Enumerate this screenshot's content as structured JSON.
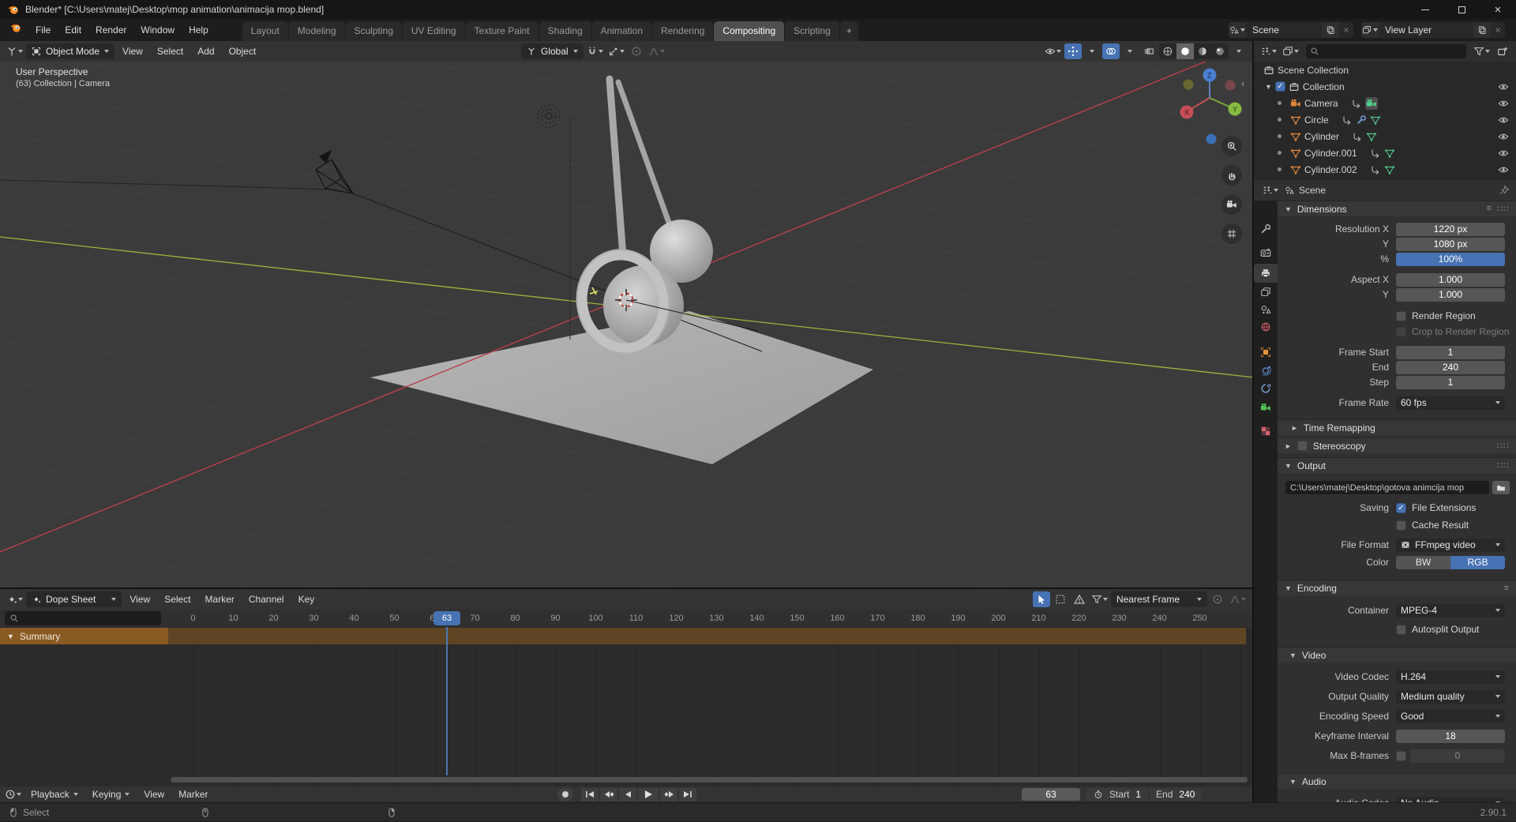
{
  "colors": {
    "accent_blue": "#4772b3",
    "summary_orange": "#8a5a23",
    "axis_red": "#b8404c",
    "axis_green": "#a3b23a",
    "object_orange": "#e0853a",
    "data_green": "#4fbf87"
  },
  "window": {
    "title": "Blender* [C:\\Users\\matej\\Desktop\\mop animation\\animacija mop.blend]"
  },
  "topbar": {
    "menus": [
      "File",
      "Edit",
      "Render",
      "Window",
      "Help"
    ],
    "workspaces": [
      "Layout",
      "Modeling",
      "Sculpting",
      "UV Editing",
      "Texture Paint",
      "Shading",
      "Animation",
      "Rendering",
      "Compositing",
      "Scripting"
    ],
    "active_workspace": "Compositing",
    "new_workspace": "+",
    "scene_selector": "Scene",
    "view_layer_selector": "View Layer"
  },
  "viewport": {
    "header": {
      "mode": "Object Mode",
      "menus": [
        "View",
        "Select",
        "Add",
        "Object"
      ],
      "orientation": "Global"
    },
    "overlay": {
      "line1": "User Perspective",
      "line2": "(63) Collection | Camera"
    },
    "gizmo": {
      "x": "X",
      "y": "Y",
      "z": "Z"
    }
  },
  "outliner": {
    "scene_collection": "Scene Collection",
    "collection": "Collection",
    "camera": "Camera",
    "circle": "Circle",
    "cylinder": "Cylinder",
    "cylinder_001": "Cylinder.001",
    "cylinder_002": "Cylinder.002"
  },
  "properties": {
    "breadcrumb": "Scene",
    "dimensions": {
      "title": "Dimensions",
      "resolution_x_label": "Resolution X",
      "resolution_x": "1220 px",
      "resolution_y_label": "Y",
      "resolution_y": "1080 px",
      "percent_label": "%",
      "percent": "100%",
      "aspect_x_label": "Aspect X",
      "aspect_x": "1.000",
      "aspect_y_label": "Y",
      "aspect_y": "1.000",
      "render_region": "Render Region",
      "crop_to_render_region": "Crop to Render Region",
      "frame_start_label": "Frame Start",
      "frame_start": "1",
      "end_label": "End",
      "end": "240",
      "step_label": "Step",
      "step": "1",
      "frame_rate_label": "Frame Rate",
      "frame_rate": "60 fps"
    },
    "time_remapping": {
      "title": "Time Remapping"
    },
    "stereoscopy": {
      "title": "Stereoscopy"
    },
    "output": {
      "title": "Output",
      "path": "C:\\Users\\matej\\Desktop\\gotova animcija mop",
      "saving_label": "Saving",
      "file_extensions": "File Extensions",
      "cache_result": "Cache Result",
      "file_format_label": "File Format",
      "file_format": "FFmpeg video",
      "color_label": "Color",
      "bw": "BW",
      "rgb": "RGB"
    },
    "encoding": {
      "title": "Encoding",
      "container_label": "Container",
      "container": "MPEG-4",
      "autosplit_output": "Autosplit Output"
    },
    "video": {
      "title": "Video",
      "video_codec_label": "Video Codec",
      "video_codec": "H.264",
      "output_quality_label": "Output Quality",
      "output_quality": "Medium quality",
      "encoding_speed_label": "Encoding Speed",
      "encoding_speed": "Good",
      "keyframe_interval_label": "Keyframe Interval",
      "keyframe_interval": "18",
      "max_b_frames_label": "Max B-frames",
      "max_b_frames": "0"
    },
    "audio": {
      "title": "Audio",
      "audio_codec_label": "Audio Codec",
      "audio_codec": "No Audio"
    }
  },
  "dope_sheet": {
    "editor": "Dope Sheet",
    "menus": [
      "View",
      "Select",
      "Marker",
      "Channel",
      "Key"
    ],
    "snap_mode": "Nearest Frame",
    "ruler": [
      "0",
      "10",
      "20",
      "30",
      "40",
      "50",
      "60",
      "70",
      "80",
      "90",
      "100",
      "110",
      "120",
      "130",
      "140",
      "150",
      "160",
      "170",
      "180",
      "190",
      "200",
      "210",
      "220",
      "230",
      "240",
      "250"
    ],
    "current_frame": "63",
    "summary": "Summary"
  },
  "timeline": {
    "menus": [
      "Playback",
      "Keying",
      "View",
      "Marker"
    ],
    "current_frame": "63",
    "start_label": "Start",
    "start": "1",
    "end_label": "End",
    "end": "240"
  },
  "status": {
    "select_hint": "Select",
    "version": "2.90.1"
  }
}
